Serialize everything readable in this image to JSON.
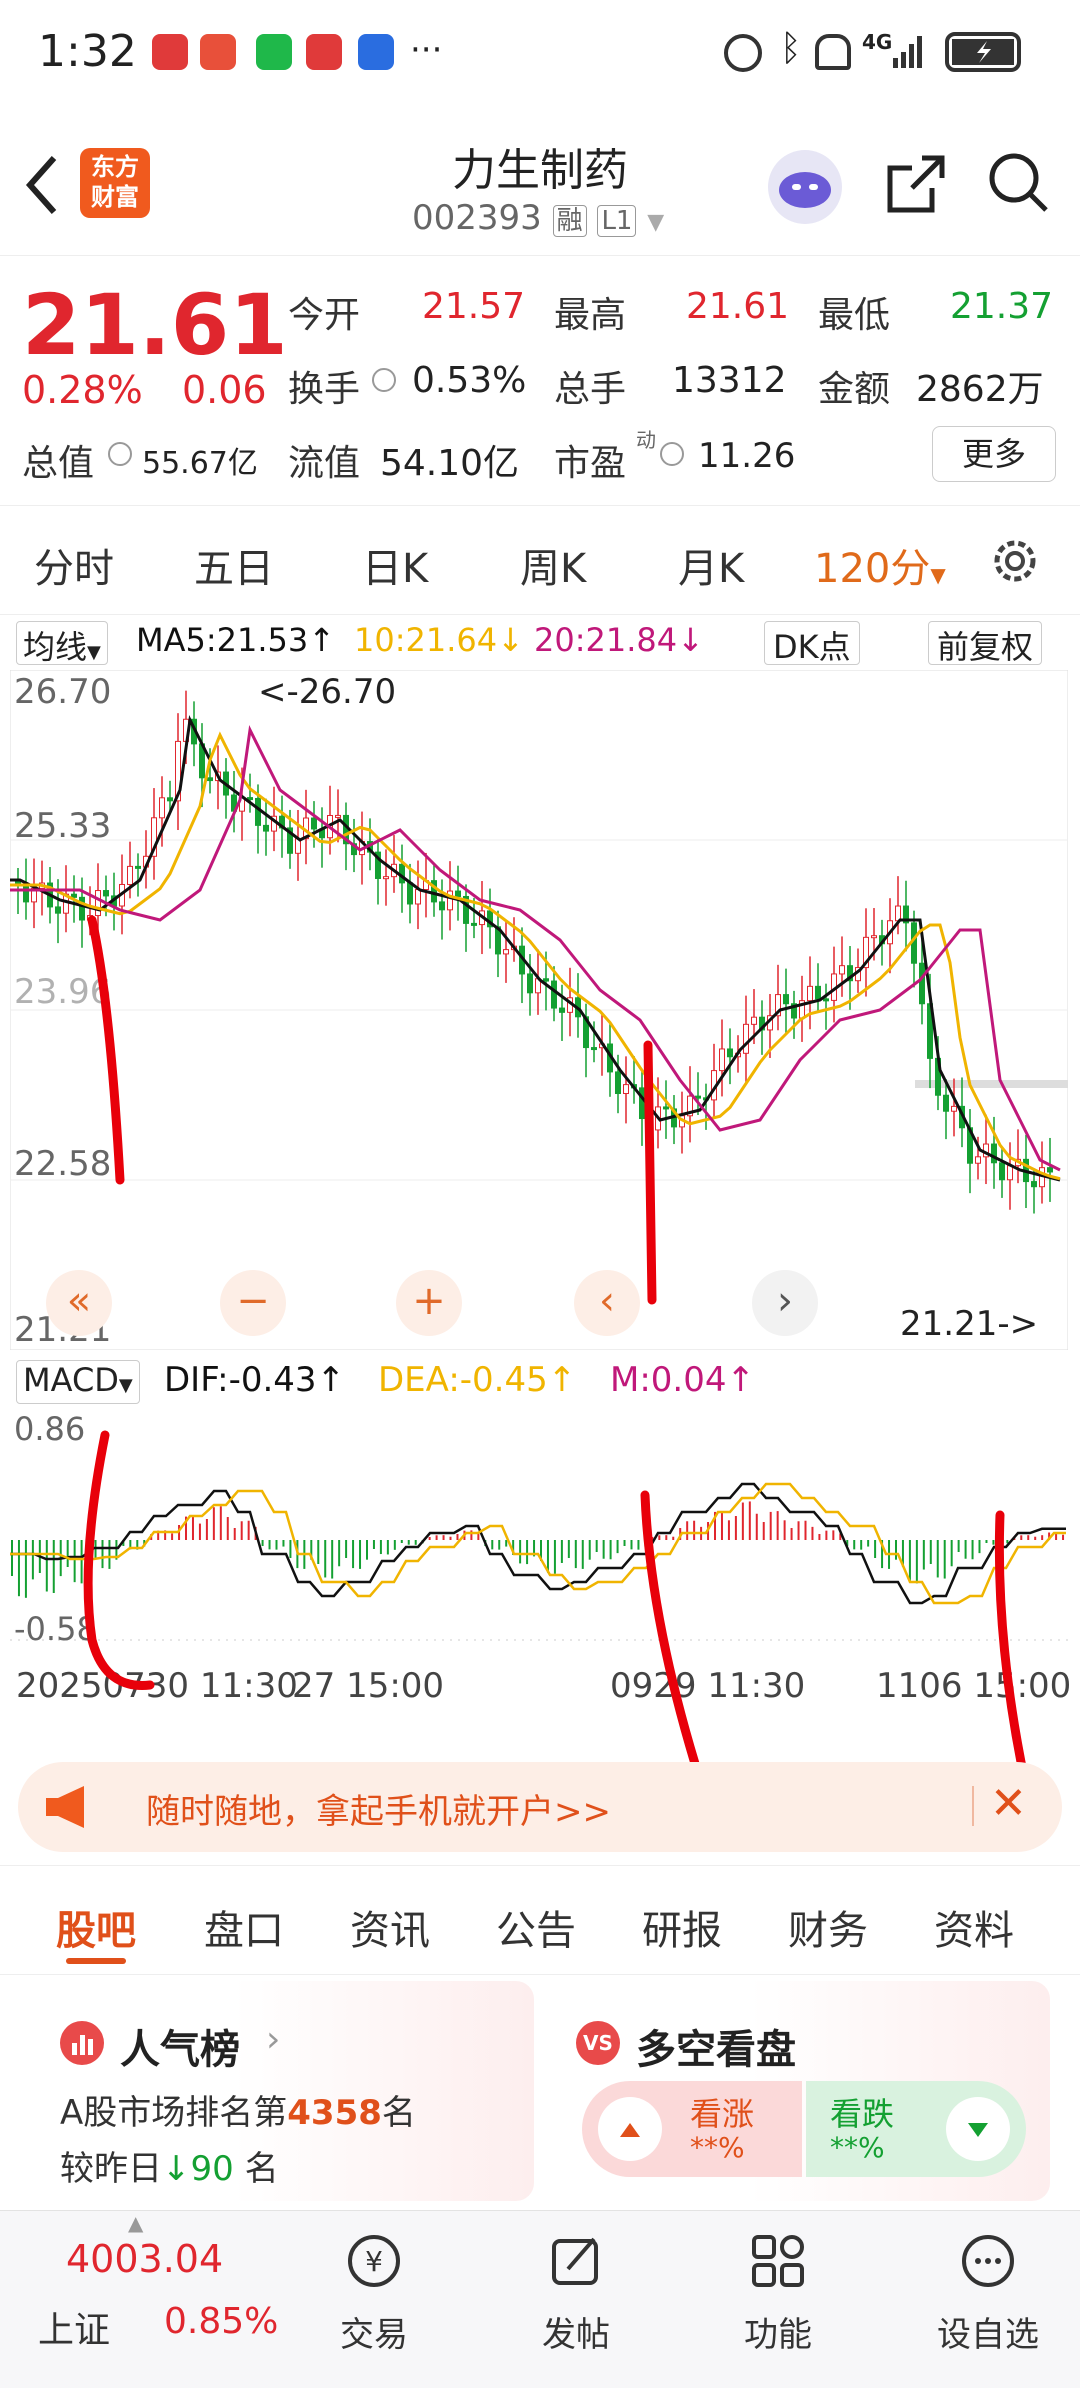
{
  "status": {
    "time": "1:32",
    "dots": "···",
    "network": "4G"
  },
  "header": {
    "logo_line1": "东方",
    "logo_line2": "财富",
    "title": "力生制药",
    "code": "002393",
    "badge1": "融",
    "badge2": "L1"
  },
  "quote": {
    "price": "21.61",
    "change_pct": "0.28%",
    "change": "0.06",
    "open_label": "今开",
    "open": "21.57",
    "high_label": "最高",
    "high": "21.61",
    "low_label": "最低",
    "low": "21.37",
    "turnover_label": "换手",
    "turnover": "0.53%",
    "volume_label": "总手",
    "volume": "13312",
    "amount_label": "金额",
    "amount": "2862万",
    "mktcap_label": "总值",
    "mktcap": "55.67亿",
    "float_label": "流值",
    "float": "54.10亿",
    "pe_label": "市盈",
    "pe_sup": "动",
    "pe": "11.26",
    "more": "更多"
  },
  "tabs": [
    "分时",
    "五日",
    "日K",
    "周K",
    "月K",
    "120分"
  ],
  "ma_bar": {
    "selector": "均线",
    "ma5": "MA5:21.53",
    "ma10": "10:21.64",
    "ma20": "20:21.84",
    "dk": "DK点",
    "adjust": "前复权"
  },
  "chart_data": {
    "type": "candlestick",
    "y_ticks": [
      "26.70",
      "25.33",
      "23.96",
      "22.58",
      "21.21"
    ],
    "ylim": [
      21.21,
      26.7
    ],
    "max_label": "<-26.70",
    "min_label": "21.21->",
    "colors": {
      "up": "#e0262e",
      "down": "#14a032",
      "ma5": "#111111",
      "ma10": "#f0b400",
      "ma20": "#c0187a"
    }
  },
  "macd": {
    "selector": "MACD",
    "dif": "DIF:-0.43",
    "dea": "DEA:-0.45",
    "m": "M:0.04",
    "y_top": "0.86",
    "y_bottom": "-0.58",
    "x_labels": [
      "20250730 11:30",
      "27 15:00",
      "0929 11:30",
      "1106 15:00"
    ]
  },
  "banner": {
    "text": "随时随地，拿起手机就开户>>"
  },
  "subtabs": [
    "股吧",
    "盘口",
    "资讯",
    "公告",
    "研报",
    "财务",
    "资料"
  ],
  "cards": {
    "popularity_title": "人气榜",
    "rank_text1": "A股市场排名第",
    "rank": "4358",
    "rank_text2": "名",
    "compare_text": "较昨日",
    "compare_val": "90",
    "compare_unit": "名",
    "bullbear_title": "多空看盘",
    "bull_label": "看涨",
    "bull_val": "**%",
    "bear_label": "看跌",
    "bear_val": "**%"
  },
  "bottom_nav": {
    "index_val": "4003.04",
    "index_name": "上证",
    "index_pct": "0.85%",
    "items": [
      "交易",
      "发帖",
      "功能",
      "设自选"
    ]
  }
}
